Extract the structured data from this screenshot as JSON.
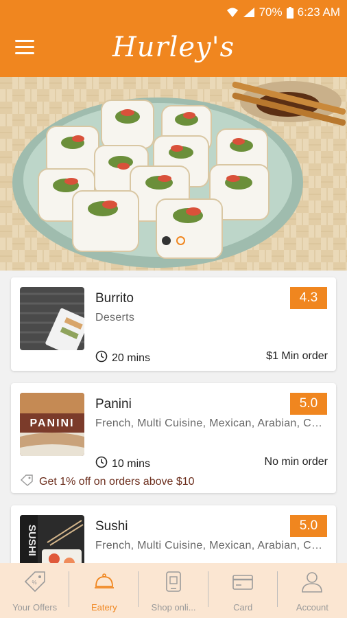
{
  "status": {
    "battery": "70%",
    "time": "6:23 AM"
  },
  "header": {
    "logo_text": "Hurley's"
  },
  "restaurants": [
    {
      "name": "Burrito",
      "cuisine": "Deserts",
      "rating": "4.3",
      "time": "20 mins",
      "min_order": "$1 Min order"
    },
    {
      "name": "Panini",
      "cuisine": "French, Multi Cuisine, Mexican, Arabian, Chi...",
      "rating": "5.0",
      "time": "10 mins",
      "min_order": "No min order",
      "offer": "Get 1% off on orders above $10",
      "thumb_text": "PANINI"
    },
    {
      "name": "Sushi",
      "cuisine": "French, Multi Cuisine, Mexican, Arabian, Chi...",
      "rating": "5.0",
      "thumb_text": "SUSHI"
    }
  ],
  "nav": [
    {
      "label": "Your Offers",
      "icon": "tag-icon"
    },
    {
      "label": "Eatery",
      "icon": "cloche-icon"
    },
    {
      "label": "Shop onli...",
      "icon": "shop-icon"
    },
    {
      "label": "Card",
      "icon": "card-icon"
    },
    {
      "label": "Account",
      "icon": "user-icon"
    }
  ],
  "colors": {
    "accent": "#f0861f",
    "nav_bg": "#fbe6d2"
  }
}
